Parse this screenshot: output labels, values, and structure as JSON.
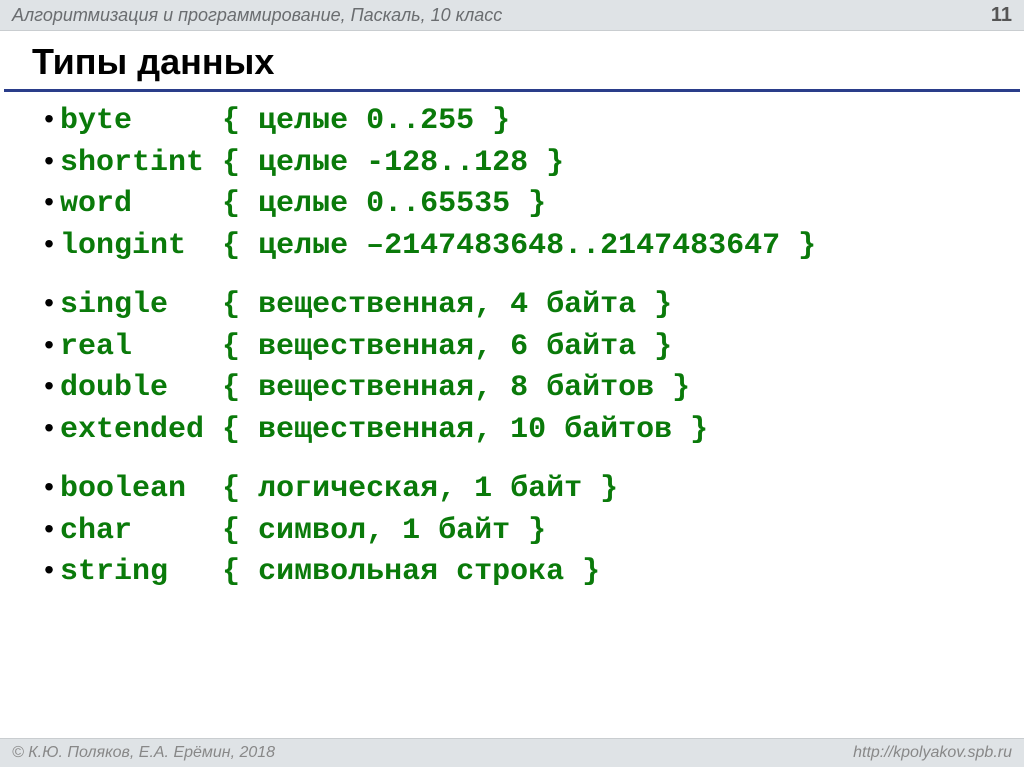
{
  "header": {
    "subject": "Алгоритмизация и программирование, Паскаль, 10 класс",
    "page": "11"
  },
  "title": "Типы данных",
  "groups": [
    [
      {
        "name": "byte",
        "pad": "    ",
        "desc": "{ целые 0..255 }"
      },
      {
        "name": "shortint",
        "pad": "",
        "desc": "{ целые -128..128 }"
      },
      {
        "name": "word",
        "pad": "    ",
        "desc": "{ целые 0..65535 }"
      },
      {
        "name": "longint",
        "pad": " ",
        "desc": "{ целые –2147483648..2147483647 }"
      }
    ],
    [
      {
        "name": "single",
        "pad": "  ",
        "desc": "{ вещественная, 4 байта }"
      },
      {
        "name": "real",
        "pad": "    ",
        "desc": "{ вещественная, 6 байта }"
      },
      {
        "name": "double",
        "pad": "  ",
        "desc": "{ вещественная, 8 байтов }"
      },
      {
        "name": "extended",
        "pad": "",
        "desc": "{ вещественная, 10 байтов }"
      }
    ],
    [
      {
        "name": "boolean",
        "pad": " ",
        "desc": "{ логическая, 1 байт }"
      },
      {
        "name": "char",
        "pad": "    ",
        "desc": "{ символ, 1 байт }"
      },
      {
        "name": "string",
        "pad": "  ",
        "desc": "{ символьная строка }"
      }
    ]
  ],
  "footer": {
    "copyright": "© К.Ю. Поляков, Е.А. Ерёмин, 2018",
    "url": "http://kpolyakov.spb.ru"
  }
}
